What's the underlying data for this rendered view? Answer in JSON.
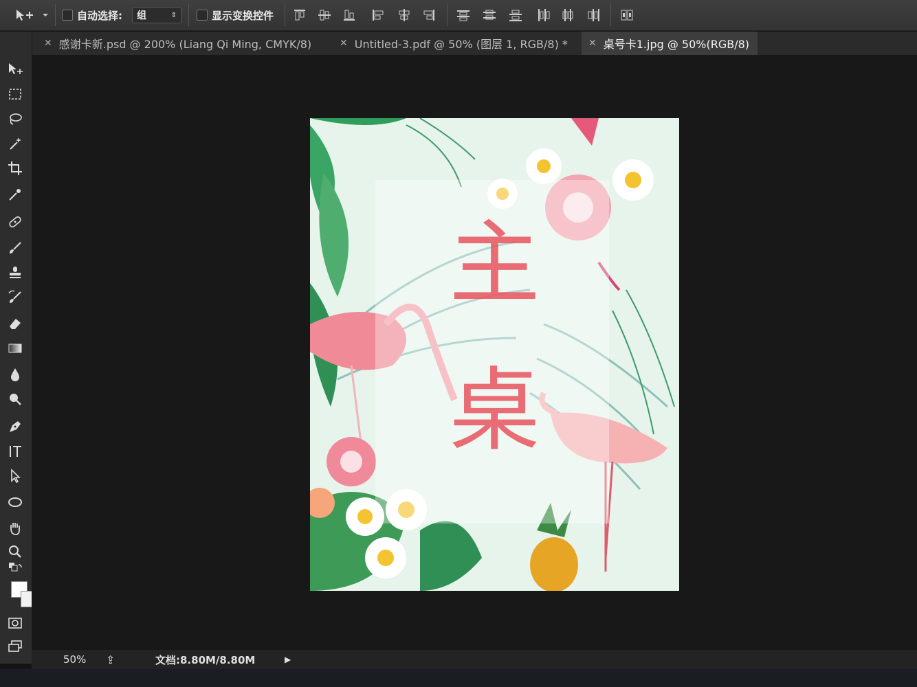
{
  "options_bar": {
    "auto_select_label": "自动选择:",
    "auto_select_value": "组",
    "show_transform_label": "显示变换控件"
  },
  "tabs": [
    {
      "label": "感谢卡新.psd @ 200% (Liang Qi Ming, CMYK/8)",
      "active": false
    },
    {
      "label": "Untitled-3.pdf @ 50% (图层 1, RGB/8) *",
      "active": false
    },
    {
      "label": "桌号卡1.jpg @ 50%(RGB/8)",
      "active": true
    }
  ],
  "tools": [
    "move-tool-icon",
    "marquee-tool-icon",
    "lasso-tool-icon",
    "magic-wand-icon",
    "crop-tool-icon",
    "eyedropper-icon",
    "healing-brush-icon",
    "brush-tool-icon",
    "clone-stamp-icon",
    "history-brush-icon",
    "eraser-icon",
    "gradient-tool-icon",
    "blur-tool-icon",
    "dodge-tool-icon",
    "pen-tool-icon",
    "type-tool-icon",
    "path-selection-icon",
    "ellipse-tool-icon",
    "hand-tool-icon",
    "zoom-tool-icon"
  ],
  "document": {
    "char1": "主",
    "char2": "桌"
  },
  "status": {
    "zoom": "50%",
    "doc_size": "文档:8.80M/8.80M"
  },
  "colors": {
    "accent_text": "#e8535f",
    "panel_bg": "#2d2d2d",
    "canvas_bg": "#181818"
  }
}
